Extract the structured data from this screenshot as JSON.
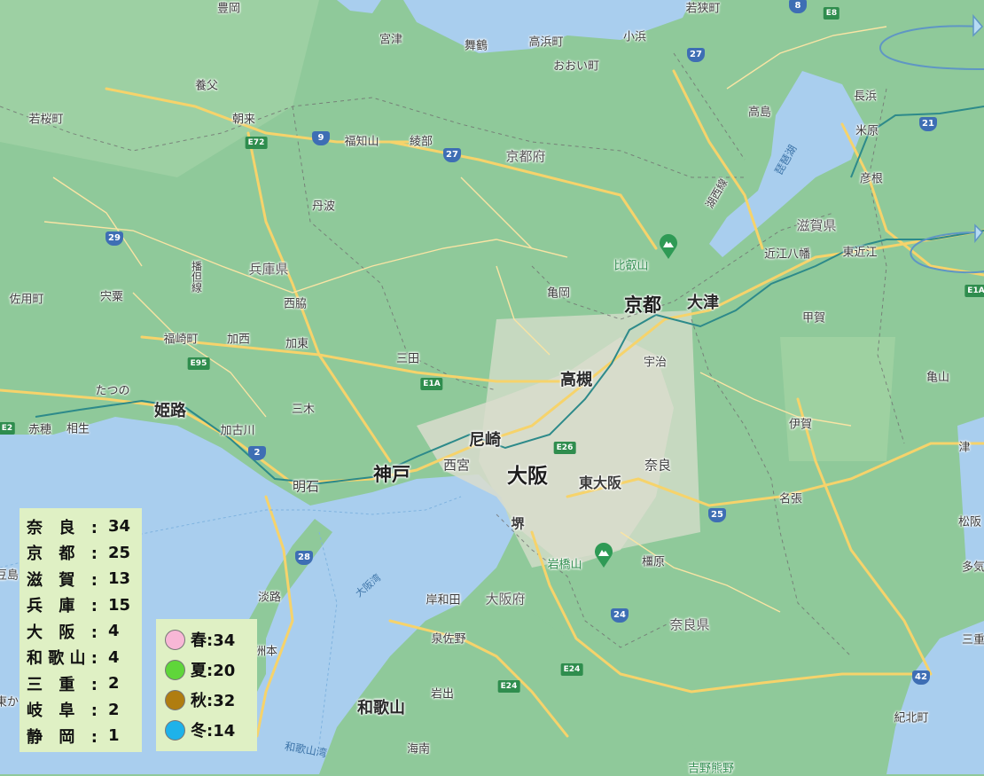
{
  "colors": {
    "land": "#8fc99a",
    "water": "#a9ceee",
    "road": "#f6d36b",
    "rail": "#2d8a8a",
    "legend_bg": "#dff0c4",
    "spring": "#f8b7d6",
    "summer": "#5fd63a",
    "autumn": "#b07d10",
    "winter": "#1eb2ea"
  },
  "places": {
    "toyooka": "豊岡",
    "miyazu": "宮津",
    "maizuru": "舞鶴",
    "takahama": "高浜町",
    "ohi": "おおい町",
    "obama": "小浜",
    "wakasa": "若狭町",
    "yabu": "養父",
    "wakasa_cho": "若桜町",
    "asago": "朝来",
    "fukuchiyama": "福知山",
    "ayabe": "綾部",
    "kyoto_pref": "京都府",
    "takashima": "高島",
    "biwako": "琵琶湖",
    "nagahama": "長浜",
    "maibara": "米原",
    "hikone": "彦根",
    "kosei": "湖西線",
    "shiga_pref": "滋賀県",
    "omihachiman": "近江八幡",
    "higashiomi": "東近江",
    "tamba": "丹波",
    "hyogo_pref": "兵庫県",
    "bantan": "播但線",
    "hieizan": "比叡山",
    "sayo": "佐用町",
    "shiso": "宍粟",
    "nishiwaki": "西脇",
    "kameoka": "亀岡",
    "kyoto": "京都",
    "otsu": "大津",
    "koka": "甲賀",
    "fukusaki": "福崎町",
    "kasai": "加西",
    "kato": "加東",
    "sanda": "三田",
    "uji": "宇治",
    "takatsuki": "高槻",
    "kameyama": "亀山",
    "tatsuno": "たつの",
    "himeji": "姫路",
    "miki": "三木",
    "kakogawa": "加古川",
    "ako": "赤穂",
    "aioi": "相生",
    "iga": "伊賀",
    "amagasaki": "尼崎",
    "nishinomiya": "西宮",
    "kobe": "神戸",
    "osaka": "大阪",
    "higashiosaka": "東大阪",
    "nara": "奈良",
    "tsu": "津",
    "akashi": "明石",
    "nabari": "名張",
    "sakai": "堺",
    "matsusaka": "松阪",
    "iwahashiyama": "岩橋山",
    "kashihara": "橿原",
    "taki": "多気",
    "osaka_bay": "大阪湾",
    "awaji": "淡路",
    "kishiwada": "岸和田",
    "osaka_pref": "大阪府",
    "nara_pref": "奈良県",
    "mie": "三重",
    "izumisano": "泉佐野",
    "sumoto": "洲本",
    "iwade": "岩出",
    "wakayama": "和歌山",
    "kihoku": "紀北町",
    "kainan": "海南",
    "wakayama_bay": "和歌山湾",
    "yoshino": "吉野熊野",
    "shodo": "豆島",
    "higashi": "東か"
  },
  "routes": {
    "r8": "8",
    "e8": "E8",
    "r27a": "27",
    "r27b": "27",
    "r9": "9",
    "e72": "E72",
    "r21": "21",
    "r29": "29",
    "e95": "E95",
    "e1a": "E1A",
    "e1a_east": "E1A",
    "e2": "E2",
    "r2": "2",
    "e26": "E26",
    "r25": "25",
    "r28": "28",
    "r24": "24",
    "e24a": "E24",
    "e24b": "E24",
    "r42": "42"
  },
  "legend_pref": [
    {
      "name": "奈良:",
      "value": "34"
    },
    {
      "name": "京都:",
      "value": "25"
    },
    {
      "name": "滋賀:",
      "value": "13"
    },
    {
      "name": "兵庫:",
      "value": "15"
    },
    {
      "name": "大阪:",
      "value": "4"
    },
    {
      "name": "和歌山:",
      "value": "4"
    },
    {
      "name": "三重:",
      "value": "2"
    },
    {
      "name": "岐阜:",
      "value": "2"
    },
    {
      "name": "静岡:",
      "value": "1"
    }
  ],
  "legend_season": [
    {
      "label": "春:34",
      "color": "#f8b7d6"
    },
    {
      "label": "夏:20",
      "color": "#5fd63a"
    },
    {
      "label": "秋:32",
      "color": "#b07d10"
    },
    {
      "label": "冬:14",
      "color": "#1eb2ea"
    }
  ]
}
